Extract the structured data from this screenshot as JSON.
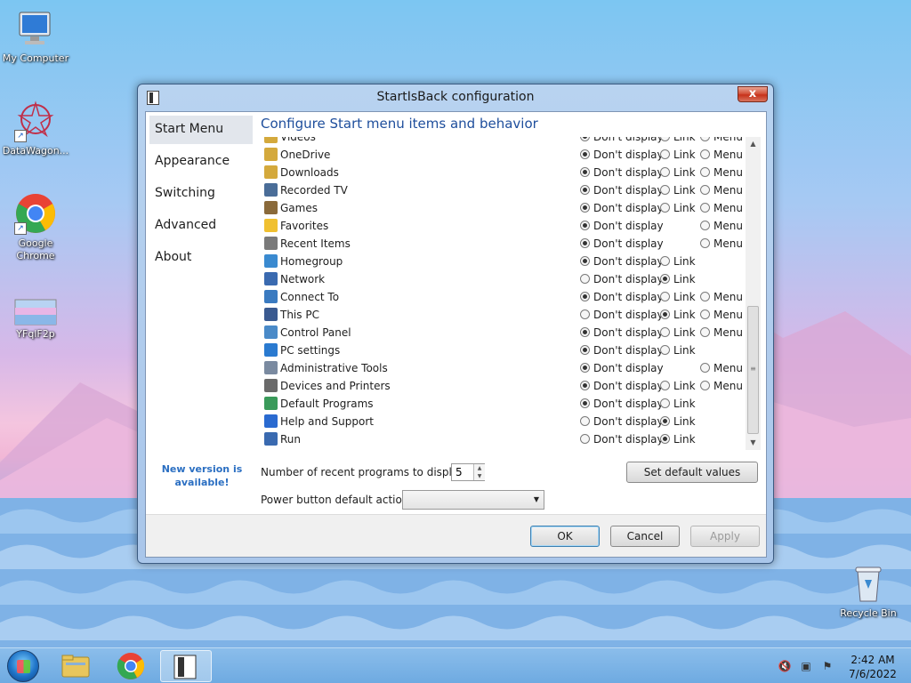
{
  "desktop": {
    "icons": [
      {
        "label": "My Computer",
        "icon": "computer-icon"
      },
      {
        "label": "DataWagon...",
        "icon": "datawagon-icon"
      },
      {
        "label": "Google Chrome",
        "icon": "chrome-icon"
      },
      {
        "label": "YFqlF2p",
        "icon": "image-file-icon"
      },
      {
        "label": "Recycle Bin",
        "icon": "recycle-bin-icon"
      }
    ]
  },
  "window": {
    "title": "StartIsBack configuration",
    "close_label": "x",
    "nav": [
      "Start Menu",
      "Appearance",
      "Switching",
      "Advanced",
      "About"
    ],
    "nav_active": "Start Menu",
    "heading": "Configure Start menu items and behavior",
    "new_version": "New version is available!",
    "option_labels": {
      "dont": "Don't display",
      "link": "Link",
      "menu": "Menu"
    },
    "items": [
      {
        "label": "Videos",
        "icon": "videos-icon",
        "color": "#d4a93c",
        "options": [
          "dont",
          "link",
          "menu"
        ],
        "selected": "dont"
      },
      {
        "label": "OneDrive",
        "icon": "onedrive-icon",
        "color": "#d4a93c",
        "options": [
          "dont",
          "link",
          "menu"
        ],
        "selected": "dont"
      },
      {
        "label": "Downloads",
        "icon": "downloads-icon",
        "color": "#d4a93c",
        "options": [
          "dont",
          "link",
          "menu"
        ],
        "selected": "dont"
      },
      {
        "label": "Recorded TV",
        "icon": "tv-icon",
        "color": "#4a6d98",
        "options": [
          "dont",
          "link",
          "menu"
        ],
        "selected": "dont"
      },
      {
        "label": "Games",
        "icon": "games-icon",
        "color": "#8a6a3a",
        "options": [
          "dont",
          "link",
          "menu"
        ],
        "selected": "dont"
      },
      {
        "label": "Favorites",
        "icon": "star-icon",
        "color": "#f0c030",
        "options": [
          "dont",
          "menu"
        ],
        "selected": "dont"
      },
      {
        "label": "Recent Items",
        "icon": "recent-items-icon",
        "color": "#7a7a7a",
        "options": [
          "dont",
          "menu"
        ],
        "selected": "dont"
      },
      {
        "label": "Homegroup",
        "icon": "homegroup-icon",
        "color": "#3a8ad0",
        "options": [
          "dont",
          "link"
        ],
        "selected": "dont"
      },
      {
        "label": "Network",
        "icon": "network-icon",
        "color": "#3a6ab0",
        "options": [
          "dont",
          "link"
        ],
        "selected": "link"
      },
      {
        "label": "Connect To",
        "icon": "connect-icon",
        "color": "#3a7ac0",
        "options": [
          "dont",
          "link",
          "menu"
        ],
        "selected": "dont"
      },
      {
        "label": "This PC",
        "icon": "this-pc-icon",
        "color": "#3a5a90",
        "options": [
          "dont",
          "link",
          "menu"
        ],
        "selected": "link"
      },
      {
        "label": "Control Panel",
        "icon": "control-panel-icon",
        "color": "#4a8ac8",
        "options": [
          "dont",
          "link",
          "menu"
        ],
        "selected": "dont"
      },
      {
        "label": "PC settings",
        "icon": "gear-icon",
        "color": "#2a7ad0",
        "options": [
          "dont",
          "link"
        ],
        "selected": "dont"
      },
      {
        "label": "Administrative Tools",
        "icon": "admin-tools-icon",
        "color": "#7a8aa0",
        "options": [
          "dont",
          "menu"
        ],
        "selected": "dont"
      },
      {
        "label": "Devices and Printers",
        "icon": "printer-icon",
        "color": "#6a6a6a",
        "options": [
          "dont",
          "link",
          "menu"
        ],
        "selected": "dont"
      },
      {
        "label": "Default Programs",
        "icon": "default-programs-icon",
        "color": "#3a9a5a",
        "options": [
          "dont",
          "link"
        ],
        "selected": "dont"
      },
      {
        "label": "Help and Support",
        "icon": "help-icon",
        "color": "#2a6ad0",
        "options": [
          "dont",
          "link"
        ],
        "selected": "link"
      },
      {
        "label": "Run",
        "icon": "run-icon",
        "color": "#3a6ab0",
        "options": [
          "dont",
          "link"
        ],
        "selected": "link"
      }
    ],
    "recent_label": "Number of recent programs to display:",
    "recent_value": "5",
    "power_label": "Power button default action:",
    "power_value": "",
    "set_default": "Set default values",
    "ok": "OK",
    "cancel": "Cancel",
    "apply": "Apply"
  },
  "taskbar": {
    "time": "2:42 AM",
    "date": "7/6/2022",
    "apps": [
      "windows-explorer-icon",
      "chrome-icon",
      "startisback-icon"
    ]
  }
}
